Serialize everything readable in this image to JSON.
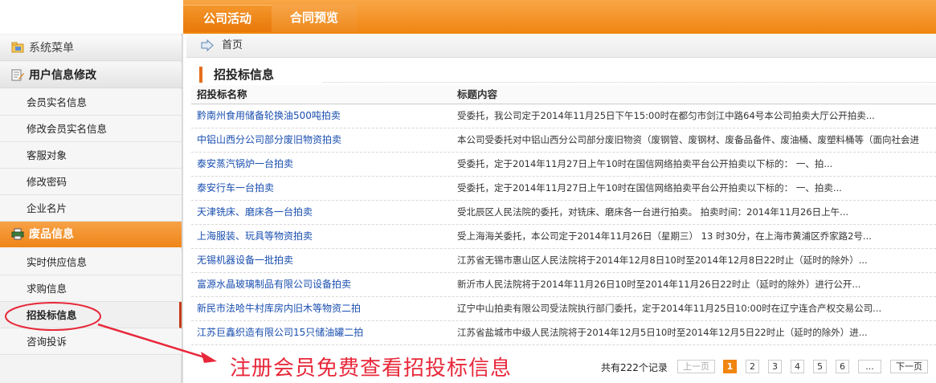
{
  "top_tabs": [
    "公司活动",
    "合同预览"
  ],
  "sidebar": {
    "menu_title": "系统菜单",
    "user_section": "用户信息修改",
    "user_items": [
      "会员实名信息",
      "修改会员实名信息",
      "客服对象",
      "修改密码",
      "企业名片"
    ],
    "waste_section": "废品信息",
    "waste_items": [
      "实时供应信息",
      "求购信息",
      "招投标信息",
      "咨询投诉"
    ]
  },
  "breadcrumb": {
    "home": "首页"
  },
  "section": {
    "title": "招投标信息"
  },
  "table": {
    "columns": [
      "招投标名称",
      "标题内容"
    ],
    "rows": [
      {
        "name": "黔南州食用储备轮换油500吨拍卖",
        "content": "受委托，我公司定于2014年11月25日下午15:00时在都匀市剑江中路64号本公司拍卖大厅公开拍卖..."
      },
      {
        "name": "中铝山西分公司部分废旧物资拍卖",
        "content": "本公司受委托对中铝山西分公司部分废旧物资（废钢管、废钢材、废备品备件、废油桶、废塑料桶等（面向社会进"
      },
      {
        "name": "泰安蒸汽锅炉一台拍卖",
        "content": "受委托，定于2014年11月27日上午10时在国信网络拍卖平台公开拍卖以下标的：  一、拍..."
      },
      {
        "name": "泰安行车一台拍卖",
        "content": "受委托，定于2014年11月27日上午10时在国信网络拍卖平台公开拍卖以下标的：  一、拍卖..."
      },
      {
        "name": "天津铣床、磨床各一台拍卖",
        "content": "受北辰区人民法院的委托，对铣床、磨床各一台进行拍卖。 拍卖时间：2014年11月26日上午..."
      },
      {
        "name": "上海服装、玩具等物资拍卖",
        "content": "受上海海关委托，本公司定于2014年11月26日（星期三） 13 时30分，在上海市黄浦区乔家路2号..."
      },
      {
        "name": "无锡机器设备一批拍卖",
        "content": "江苏省无锡市惠山区人民法院将于2014年12月8日10时至2014年12月8日22时止（延时的除外）..."
      },
      {
        "name": "富源水晶玻璃制品有限公司设备拍卖",
        "content": "新沂市人民法院将于2014年11月26日10时至2014年11月26日22时止（延时的除外）进行公开..."
      },
      {
        "name": "新民市法哈牛村库房内旧木等物资二拍",
        "content": "辽宁中山拍卖有限公司受法院执行部门委托，定于2014年11月25日10:00时在辽宁连合产权交易公司..."
      },
      {
        "name": "江苏巨鑫织造有限公司15只储油罐二拍",
        "content": "江苏省盐城市中级人民法院将于2014年12月5日10时至2014年12月5日22时止（延时的除外）进..."
      }
    ]
  },
  "pagination": {
    "total": "共有222个记录",
    "prev": "上一页",
    "pages": [
      "1",
      "2",
      "3",
      "4",
      "5",
      "6",
      "..."
    ],
    "current": "1",
    "next": "下一页"
  },
  "annotation": {
    "text": "注册会员免费查看招投标信息"
  },
  "colors": {
    "orange": "#f08512",
    "link": "#1a4fb0",
    "annotation": "#e8283a"
  }
}
